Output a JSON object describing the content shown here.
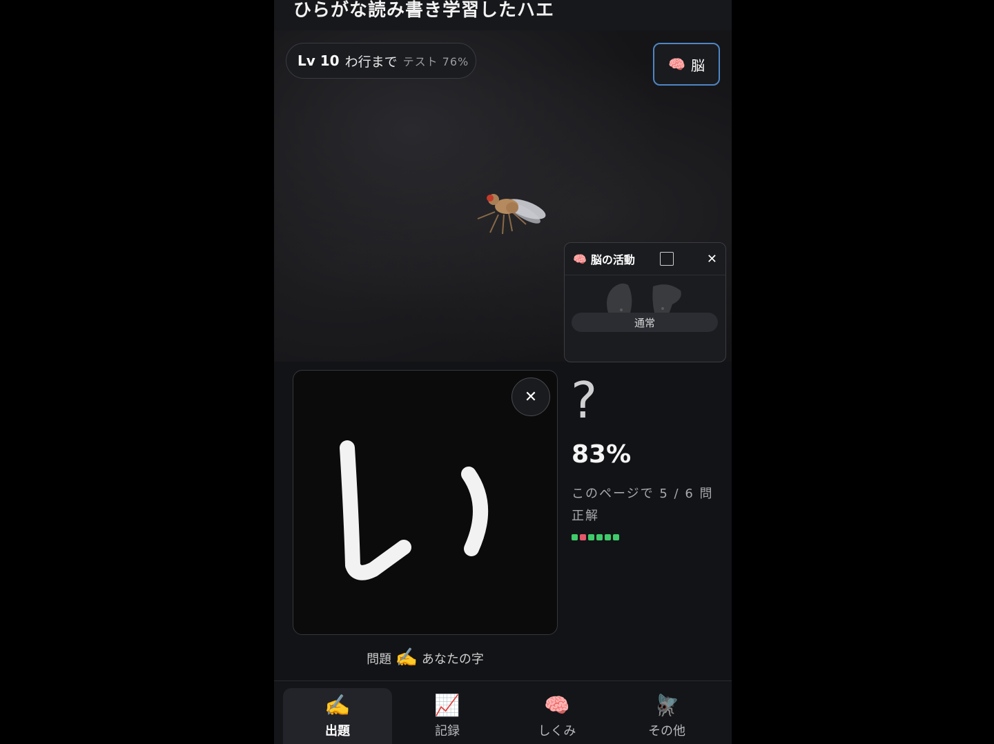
{
  "header": {
    "title": "ひらがな読み書き学習したハエ"
  },
  "level_pill": {
    "level": "Lv 10",
    "range": "わ行まで",
    "test": "テスト 76%"
  },
  "brain_button": {
    "icon": "brain-icon",
    "emoji": "🧠",
    "label": "脳"
  },
  "brain_panel": {
    "icon": "🧠",
    "title": "脳の活動",
    "close": "✕",
    "status": "通常"
  },
  "canvas": {
    "close": "✕",
    "caption_prefix": "問題",
    "caption_icon": "✍️",
    "caption_suffix": "あなたの字"
  },
  "result": {
    "guess": "?",
    "accuracy": "83%",
    "page_score": "このページで 5 / 6 問 正解",
    "history": [
      "green",
      "red",
      "green",
      "green",
      "green",
      "green"
    ],
    "colors": {
      "green": "#3fca6b",
      "red": "#e2586a"
    }
  },
  "nav": {
    "items": [
      {
        "icon": "✍️",
        "label": "出題",
        "active": true
      },
      {
        "icon": "📈",
        "label": "記録",
        "active": false
      },
      {
        "icon": "🧠",
        "label": "しくみ",
        "active": false
      },
      {
        "icon": "🪰",
        "label": "その他",
        "active": false
      }
    ]
  }
}
